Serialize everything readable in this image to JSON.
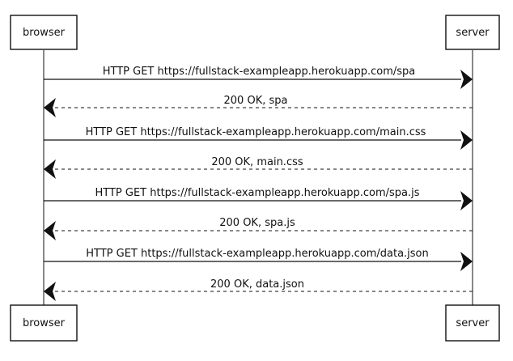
{
  "participants": {
    "left": "browser",
    "right": "server"
  },
  "messages": [
    {
      "text": "HTTP GET https://fullstack-exampleapp.herokuapp.com/spa",
      "direction": "to-server",
      "style": "solid"
    },
    {
      "text": "200 OK, spa",
      "direction": "to-browser",
      "style": "dashed"
    },
    {
      "text": "HTTP GET https://fullstack-exampleapp.herokuapp.com/main.css",
      "direction": "to-server",
      "style": "solid"
    },
    {
      "text": "200 OK, main.css",
      "direction": "to-browser",
      "style": "dashed"
    },
    {
      "text": "HTTP GET https://fullstack-exampleapp.herokuapp.com/spa.js",
      "direction": "to-server",
      "style": "solid"
    },
    {
      "text": "200 OK, spa.js",
      "direction": "to-browser",
      "style": "dashed"
    },
    {
      "text": "HTTP GET https://fullstack-exampleapp.herokuapp.com/data.json",
      "direction": "to-server",
      "style": "solid"
    },
    {
      "text": "200 OK, data.json",
      "direction": "to-browser",
      "style": "dashed"
    }
  ]
}
